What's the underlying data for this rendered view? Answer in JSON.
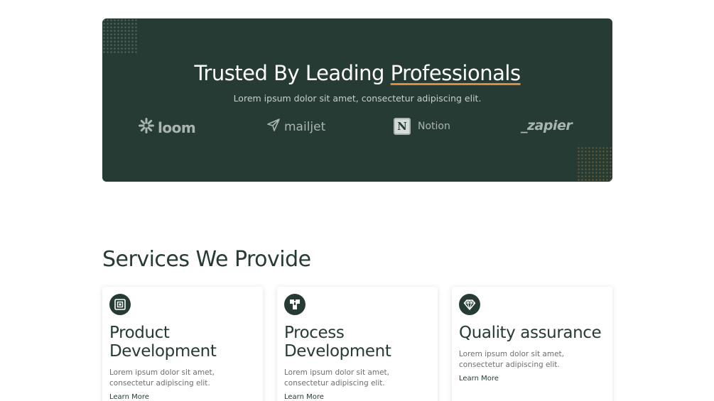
{
  "banner": {
    "title_prefix": "Trusted By Leading ",
    "title_highlight": "Professionals",
    "subtitle": "Lorem ipsum dolor sit amet, consectetur adipiscing elit.",
    "logos": [
      {
        "name": "loom",
        "icon": "loom-burst-icon"
      },
      {
        "name": "mailjet",
        "icon": "paper-plane-icon"
      },
      {
        "name": "Notion",
        "icon": "notion-n-icon",
        "glyph": "N"
      },
      {
        "name": "_zapier",
        "icon": null
      }
    ],
    "colors": {
      "background": "#253b33",
      "accent": "#e08a3c"
    }
  },
  "services": {
    "title": "Services We Provide",
    "cards": [
      {
        "icon": "device-icon",
        "title": "Product Development",
        "description": "Lorem ipsum dolor sit amet, consectetur adipiscing elit.",
        "link": "Learn More"
      },
      {
        "icon": "network-nodes-icon",
        "title": "Process Development",
        "description": "Lorem ipsum dolor sit amet, consectetur adipiscing elit.",
        "link": "Learn More"
      },
      {
        "icon": "diamond-icon",
        "title": "Quality assurance",
        "description": "Lorem ipsum dolor sit amet, consectetur adipiscing elit.",
        "link": "Learn More"
      }
    ]
  }
}
